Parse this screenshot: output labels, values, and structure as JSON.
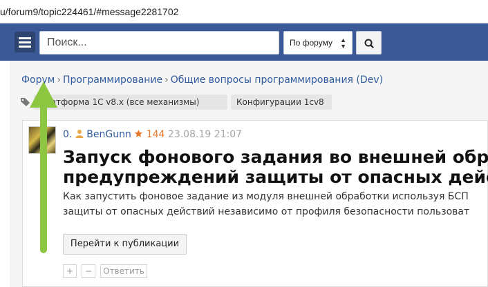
{
  "browser": {
    "url": "u/forum9/topic224461/#message2281702"
  },
  "header": {
    "menu_icon": "hamburger-menu-icon",
    "search_placeholder": "Поиск...",
    "scope_select": "По форуму",
    "search_button_icon": "search-icon",
    "accent_color": "#3a5996"
  },
  "breadcrumb": {
    "items": [
      "Форум",
      "Программирование",
      "Общие вопросы программирования (Dev)"
    ],
    "separator": "›"
  },
  "tags": {
    "icon": "tag-icon",
    "items": [
      "Платформа 1С v8.x (все механизмы)",
      "Конфигурации 1cv8"
    ]
  },
  "post": {
    "number": "0.",
    "user_icon": "user-icon",
    "author": "BenGunn",
    "rating_icon": "star-icon",
    "rating": "144",
    "date": "23.08.19 21:07",
    "title_line1": "Запуск фонового задания во внешней обра",
    "title_line2": "предупреждений защиты от опасных дейст",
    "desc_line1": "Как запустить фоновое задание из модуля внешней обработки используя БСП",
    "desc_line2": "защиты от опасных действий независимо от профиля безопасности пользоват",
    "goto_button": "Перейти к публикации",
    "plus_button": "+",
    "minus_button": "−",
    "reply_button": "Ответить"
  },
  "annotation": {
    "arrow_color": "#8dc641",
    "arrow_icon": "up-arrow-annotation-icon"
  }
}
